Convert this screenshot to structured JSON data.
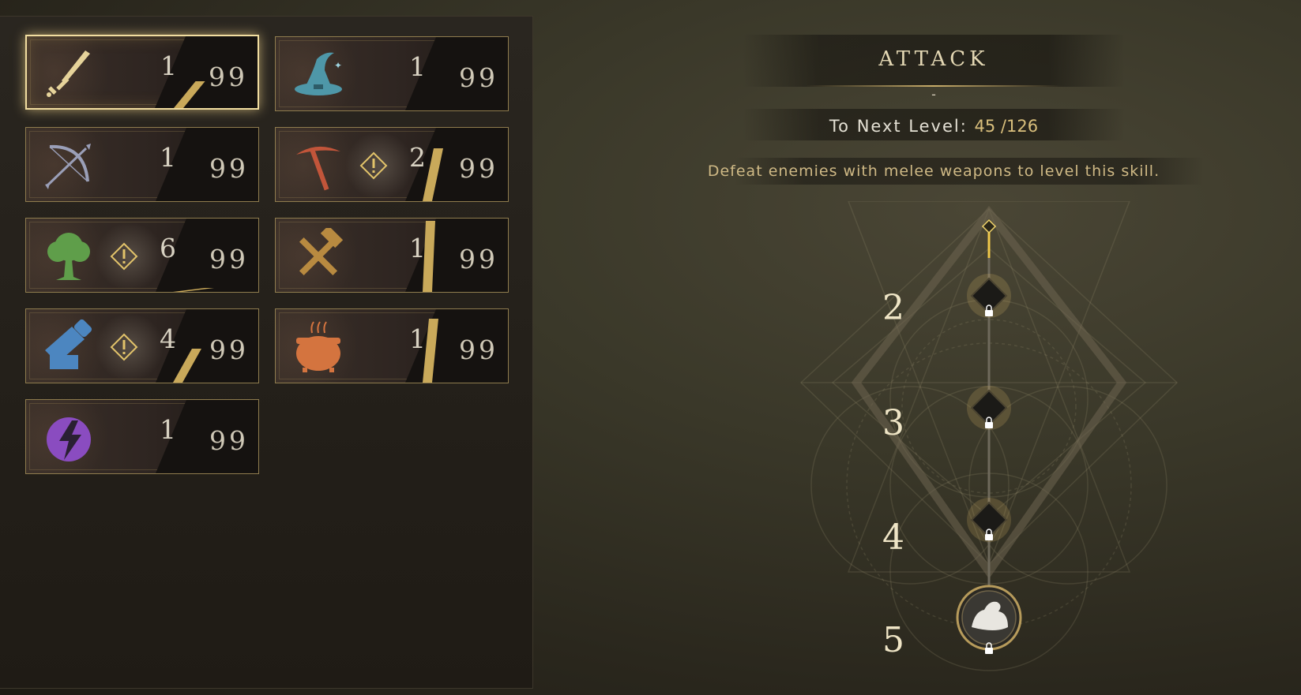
{
  "skills": [
    {
      "name": "attack",
      "icon": "sword-icon",
      "level": "1",
      "max": "99",
      "progress": 0.36,
      "alert": false,
      "selected": true
    },
    {
      "name": "magic",
      "icon": "wizard-hat-icon",
      "level": "1",
      "max": "99",
      "progress": 0.0,
      "alert": false,
      "selected": false
    },
    {
      "name": "ranged",
      "icon": "bow-icon",
      "level": "1",
      "max": "99",
      "progress": 0.0,
      "alert": false,
      "selected": false
    },
    {
      "name": "mining",
      "icon": "pickaxe-icon",
      "level": "2",
      "max": "99",
      "progress": 0.7,
      "alert": true,
      "selected": false
    },
    {
      "name": "woodcutting",
      "icon": "tree-icon",
      "level": "6",
      "max": "99",
      "progress": 0.05,
      "alert": true,
      "selected": false
    },
    {
      "name": "smithing",
      "icon": "hammers-icon",
      "level": "1",
      "max": "99",
      "progress": 0.95,
      "alert": false,
      "selected": false
    },
    {
      "name": "crafting",
      "icon": "saw-icon",
      "level": "4",
      "max": "99",
      "progress": 0.45,
      "alert": true,
      "selected": false
    },
    {
      "name": "cooking",
      "icon": "cauldron-icon",
      "level": "1",
      "max": "99",
      "progress": 0.85,
      "alert": false,
      "selected": false
    },
    {
      "name": "conjuring",
      "icon": "lightning-icon",
      "level": "1",
      "max": "99",
      "progress": 0.0,
      "alert": false,
      "selected": false
    }
  ],
  "detail": {
    "title": "ATTACK",
    "dash": "-",
    "next_label": "To Next Level:",
    "next_value": "45 /126",
    "description": "Defeat enemies with melee weapons to level this skill."
  },
  "tree": {
    "nodes": [
      "2",
      "3",
      "4",
      "5"
    ],
    "final_icon": "flexed-arm-icon"
  },
  "colors": {
    "accent": "#d9bf7c",
    "frame": "#8f7c4e",
    "selected_frame": "#f1dda0"
  }
}
